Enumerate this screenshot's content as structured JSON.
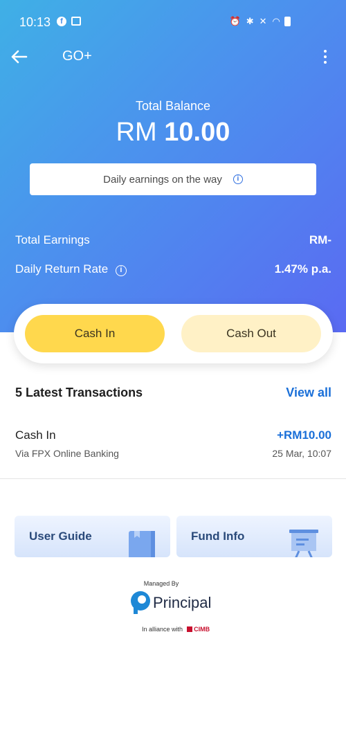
{
  "status_bar": {
    "time": "10:13"
  },
  "app_bar": {
    "title": "GO+"
  },
  "balance": {
    "label": "Total Balance",
    "currency": "RM",
    "amount": "10.00"
  },
  "banner": {
    "text": "Daily earnings on the way"
  },
  "stats": {
    "total_earnings_label": "Total Earnings",
    "total_earnings_value": "RM-",
    "return_rate_label": "Daily Return Rate",
    "return_rate_value": "1.47% p.a."
  },
  "actions": {
    "cash_in": "Cash In",
    "cash_out": "Cash Out"
  },
  "transactions": {
    "title": "5 Latest Transactions",
    "view_all": "View all",
    "items": [
      {
        "title": "Cash In",
        "subtitle": "Via FPX Online Banking",
        "amount": "+RM10.00",
        "date": "25 Mar, 10:07"
      }
    ]
  },
  "cards": {
    "user_guide": "User Guide",
    "fund_info": "Fund Info"
  },
  "footer": {
    "managed_by": "Managed By",
    "brand": "Principal",
    "alliance": "In alliance with",
    "partner": "CIMB"
  }
}
